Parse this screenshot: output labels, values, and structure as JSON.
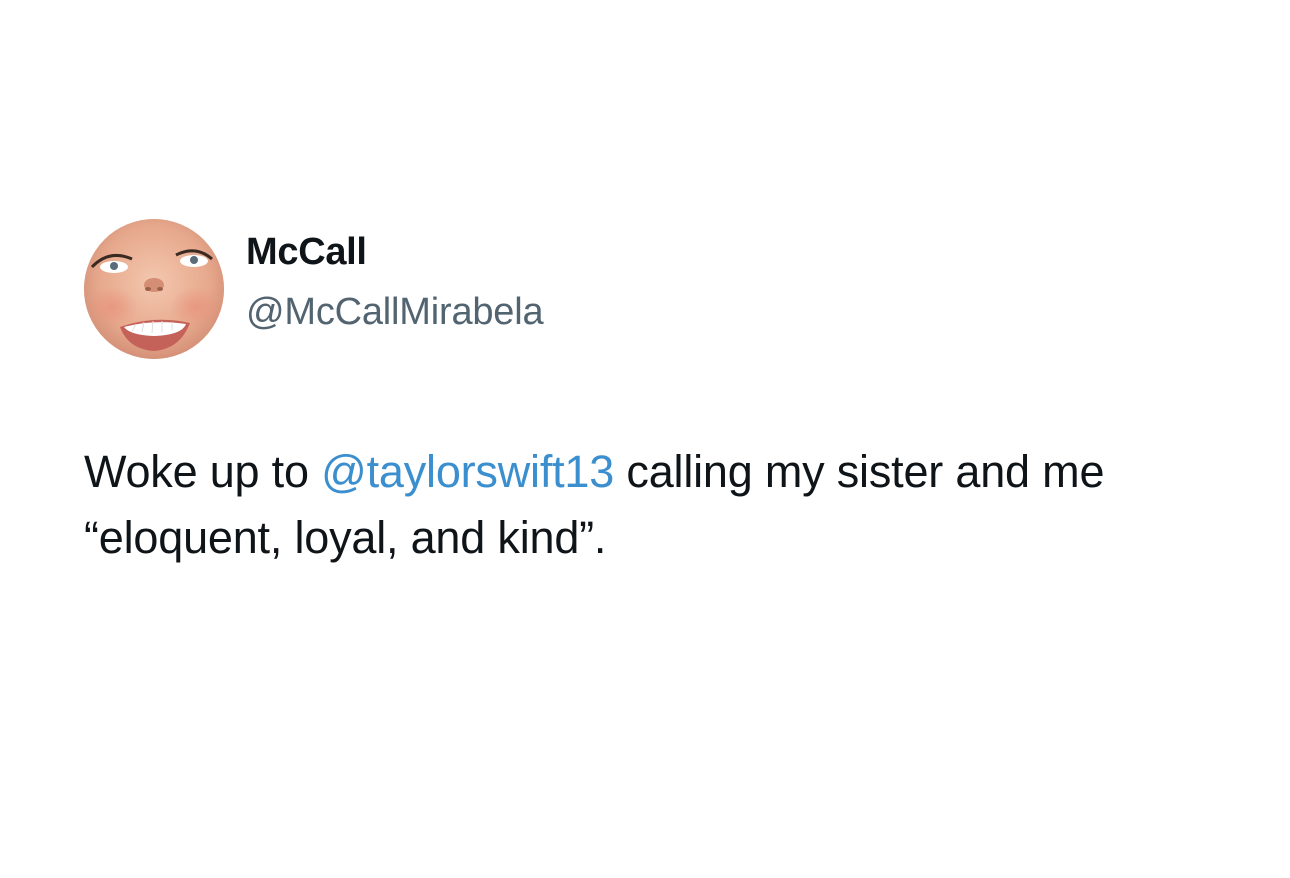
{
  "tweet": {
    "author": {
      "display_name": "McCall",
      "handle": "@McCallMirabela",
      "avatar_icon": "profile-photo-smiling-face"
    },
    "text": {
      "part1": "Woke up to ",
      "mention": "@taylorswift13",
      "part2": " calling my sister and me “eloquent, loyal, and kind”."
    }
  },
  "colors": {
    "background": "#ffffff",
    "text_primary": "#0f1419",
    "text_secondary": "#536471",
    "mention": "#3b8fce"
  }
}
